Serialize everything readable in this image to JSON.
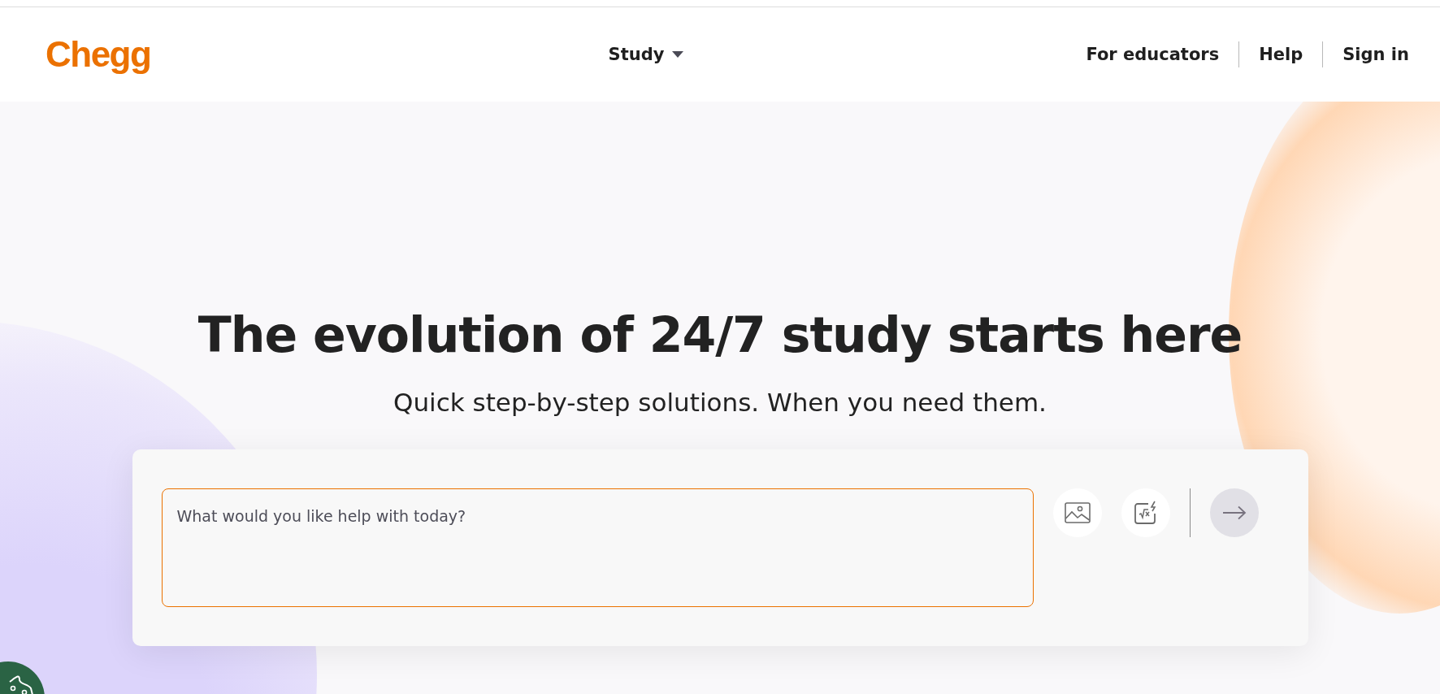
{
  "header": {
    "logo": "Chegg",
    "nav": [
      {
        "label": "Study",
        "kind": "dropdown"
      }
    ],
    "links": [
      {
        "label": "For educators"
      },
      {
        "label": "Help"
      },
      {
        "label": "Sign in"
      }
    ]
  },
  "hero": {
    "title": "The evolution of 24/7 study starts here",
    "subtitle": "Quick step-by-step solutions. When you need them."
  },
  "search": {
    "placeholder": "What would you like help with today?",
    "focused": true,
    "submit_disabled": true
  }
}
